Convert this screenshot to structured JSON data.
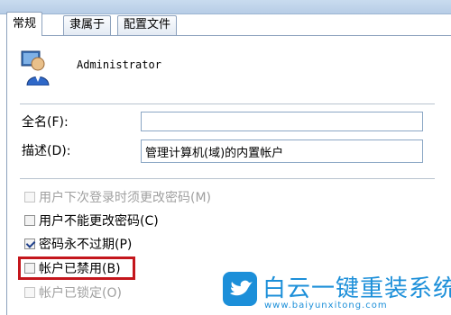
{
  "tabs": [
    {
      "label": "常规",
      "active": true
    },
    {
      "label": "隶属于",
      "active": false
    },
    {
      "label": "配置文件",
      "active": false
    }
  ],
  "user": {
    "name": "Administrator",
    "icon": "user-account-icon"
  },
  "fields": {
    "fullname_label": "全名(F):",
    "fullname_value": "",
    "description_label": "描述(D):",
    "description_value": "管理计算机(域)的内置帐户"
  },
  "options": [
    {
      "label": "用户下次登录时须更改密码(M)",
      "checked": false,
      "enabled": false
    },
    {
      "label": "用户不能更改密码(C)",
      "checked": false,
      "enabled": true
    },
    {
      "label": "密码永不过期(P)",
      "checked": true,
      "enabled": true
    },
    {
      "label": "帐户已禁用(B)",
      "checked": false,
      "enabled": true,
      "highlighted": true
    },
    {
      "label": "帐户已锁定(O)",
      "checked": false,
      "enabled": false
    }
  ],
  "watermark": {
    "title": "白云一键重装系统",
    "url": "www.baiyunxitong.com",
    "icon": "twitter-bird-icon",
    "color": "#1c8fd9"
  },
  "colors": {
    "highlight": "#c4161c"
  }
}
